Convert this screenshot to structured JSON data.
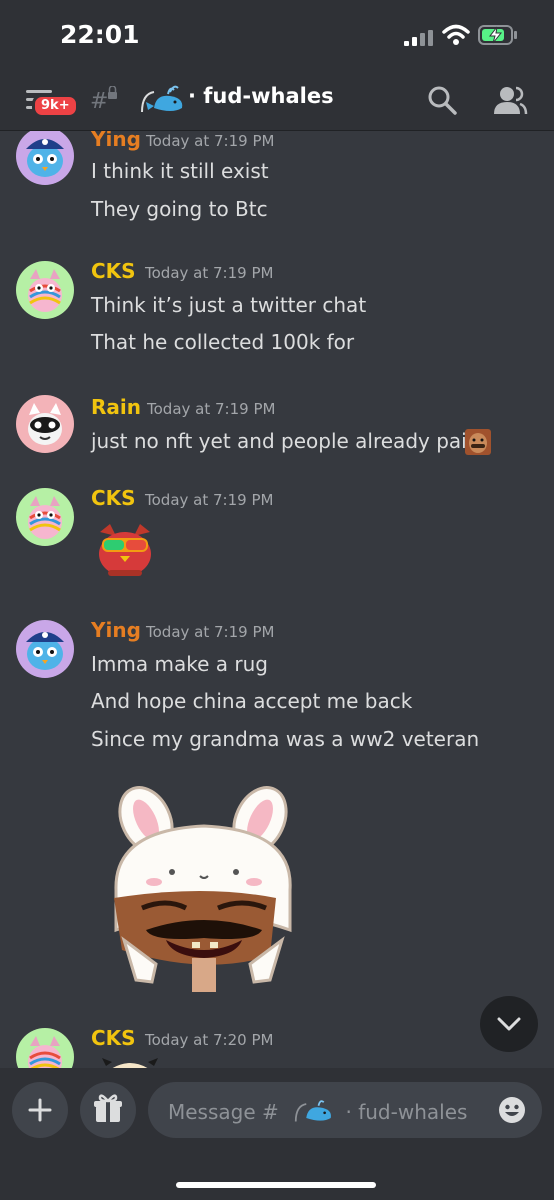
{
  "status": {
    "time": "22:01"
  },
  "header": {
    "badge": "9k+",
    "channel": "· fud-whales"
  },
  "messages": [
    {
      "user": "Ying",
      "time": "Today at 7:19 PM",
      "lines": [
        "I think it still exist",
        "They going to Btc"
      ]
    },
    {
      "user": "CKS",
      "time": "Today at 7:19 PM",
      "lines": [
        "Think it’s just a twitter chat",
        "That he collected 100k for"
      ]
    },
    {
      "user": "Rain",
      "time": "Today at 7:19 PM",
      "lines": [
        "just no nft yet and people already paid"
      ]
    },
    {
      "user": "CKS",
      "time": "Today at 7:19 PM",
      "lines": []
    },
    {
      "user": "Ying",
      "time": "Today at 7:19 PM",
      "lines": [
        "Imma make a rug",
        "And hope china accept me back",
        "Since my grandma was a ww2 veteran"
      ]
    },
    {
      "user": "CKS",
      "time": "Today at 7:20 PM",
      "lines": []
    }
  ],
  "composer": {
    "placeholder_prefix": "Message #",
    "placeholder_channel": "· fud-whales"
  },
  "colors": {
    "ying": "#e67e22",
    "cks": "#f1c40f",
    "rain": "#f1c40f",
    "badge": "#ed4245"
  },
  "icons": [
    "menu-icon",
    "threads-icon",
    "whale-icon",
    "search-icon",
    "members-icon",
    "add-icon",
    "gift-icon",
    "emoji-icon",
    "chevron-down-icon"
  ]
}
